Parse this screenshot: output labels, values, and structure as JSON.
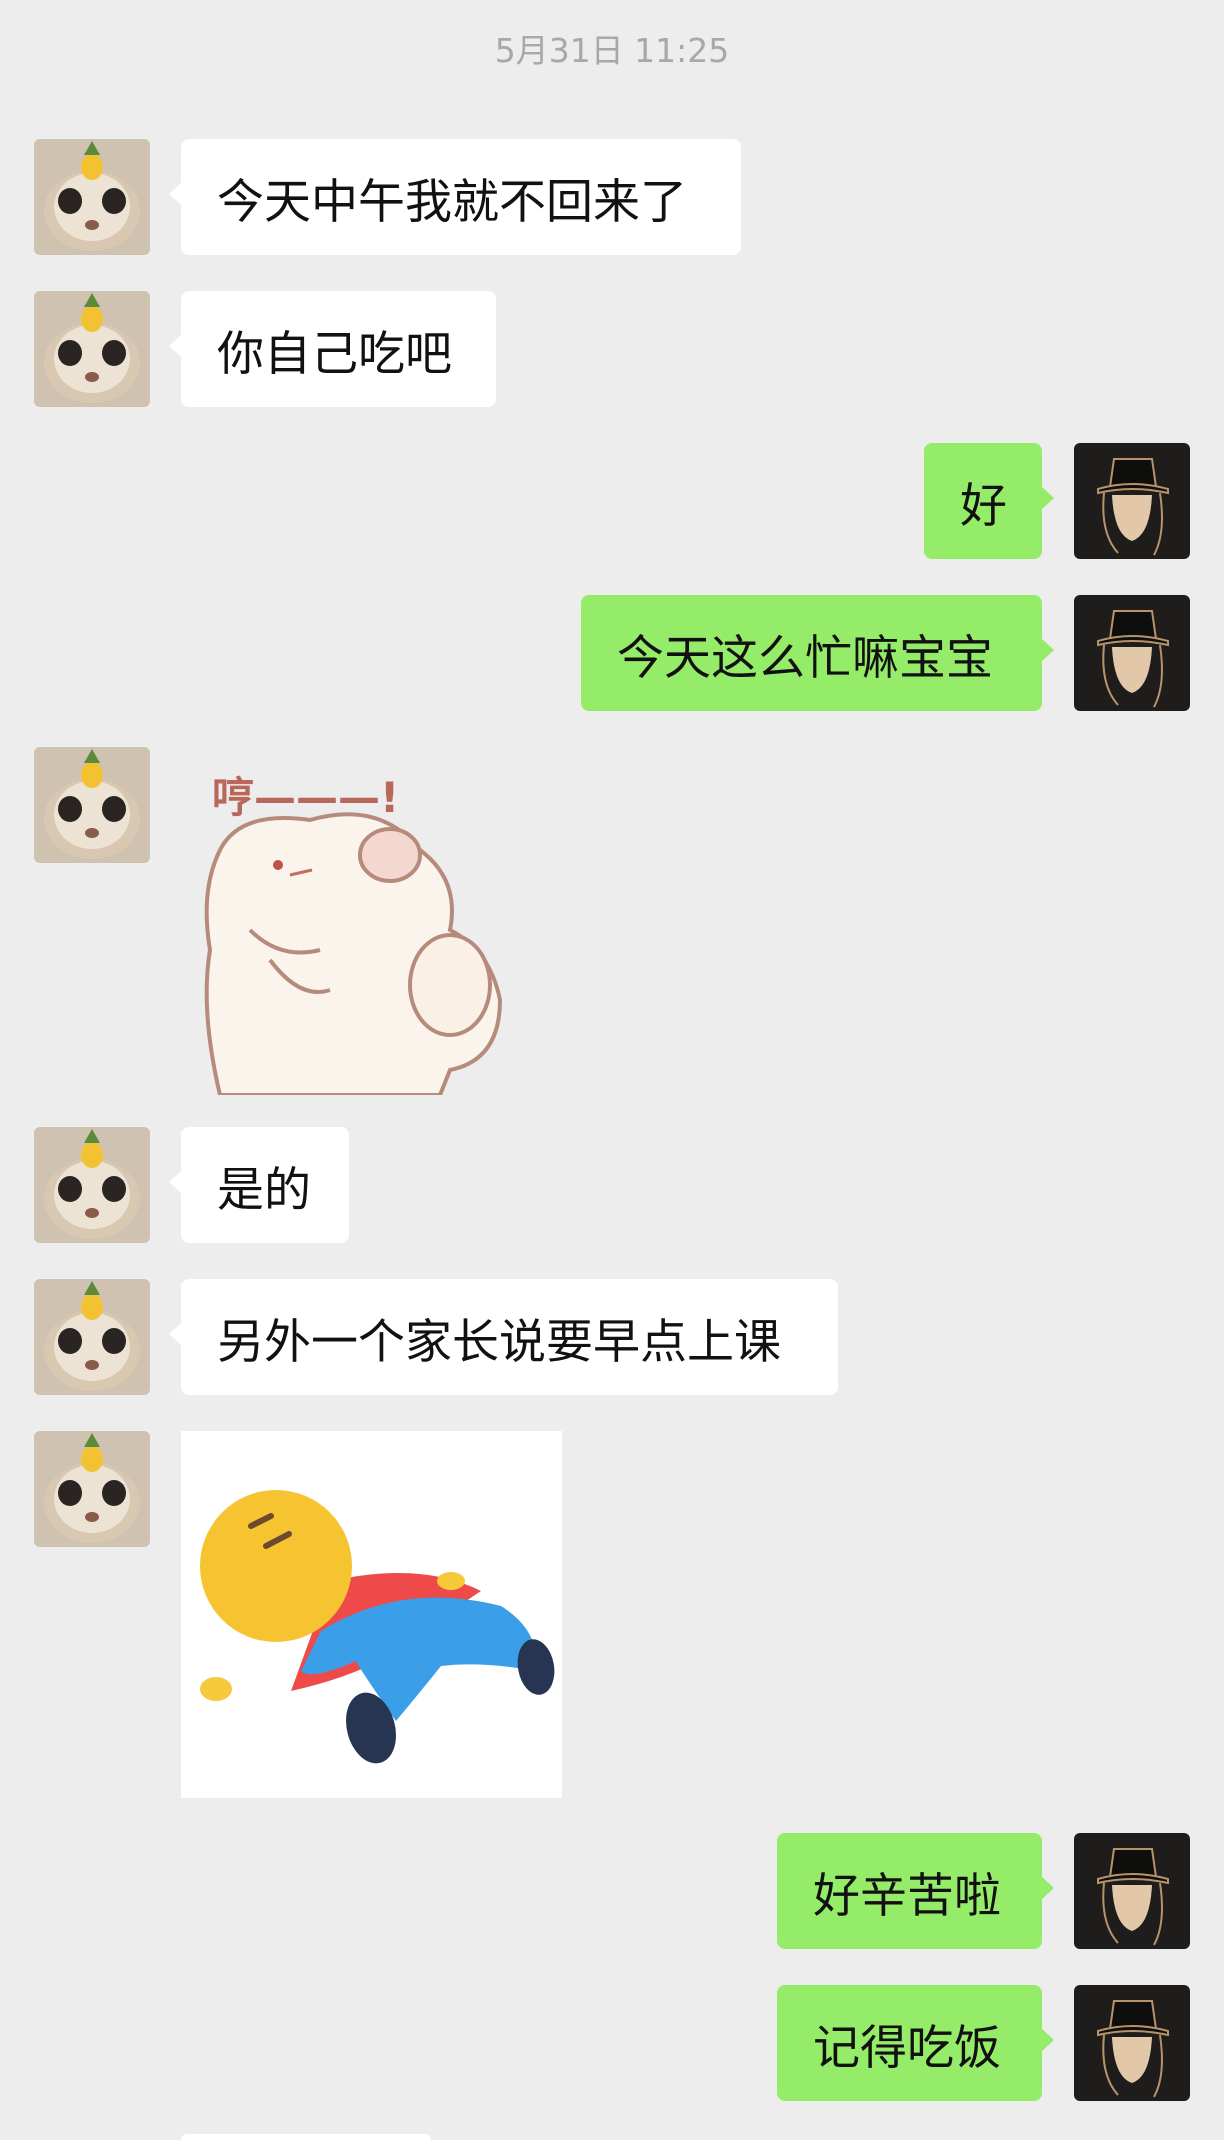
{
  "timestamp": "5月31日 11:25",
  "messages": [
    {
      "side": "left",
      "type": "text",
      "text": "今天中午我就不回来了"
    },
    {
      "side": "left",
      "type": "text",
      "text": "你自己吃吧"
    },
    {
      "side": "right",
      "type": "text",
      "text": "好"
    },
    {
      "side": "right",
      "type": "text",
      "text": "今天这么忙嘛宝宝"
    },
    {
      "side": "left",
      "type": "sticker",
      "sticker": "hamster-hmph-sticker",
      "caption": "哼———!"
    },
    {
      "side": "left",
      "type": "text",
      "text": "是的"
    },
    {
      "side": "left",
      "type": "text",
      "text": "另外一个家长说要早点上课"
    },
    {
      "side": "left",
      "type": "sticker",
      "sticker": "lying-flat-emoji-sticker"
    },
    {
      "side": "right",
      "type": "text",
      "text": "好辛苦啦"
    },
    {
      "side": "right",
      "type": "text",
      "text": "记得吃饭"
    }
  ],
  "colors": {
    "background": "#ededed",
    "sent_bubble": "#95ec69",
    "received_bubble": "#ffffff",
    "timestamp_text": "#a8a8a8"
  }
}
